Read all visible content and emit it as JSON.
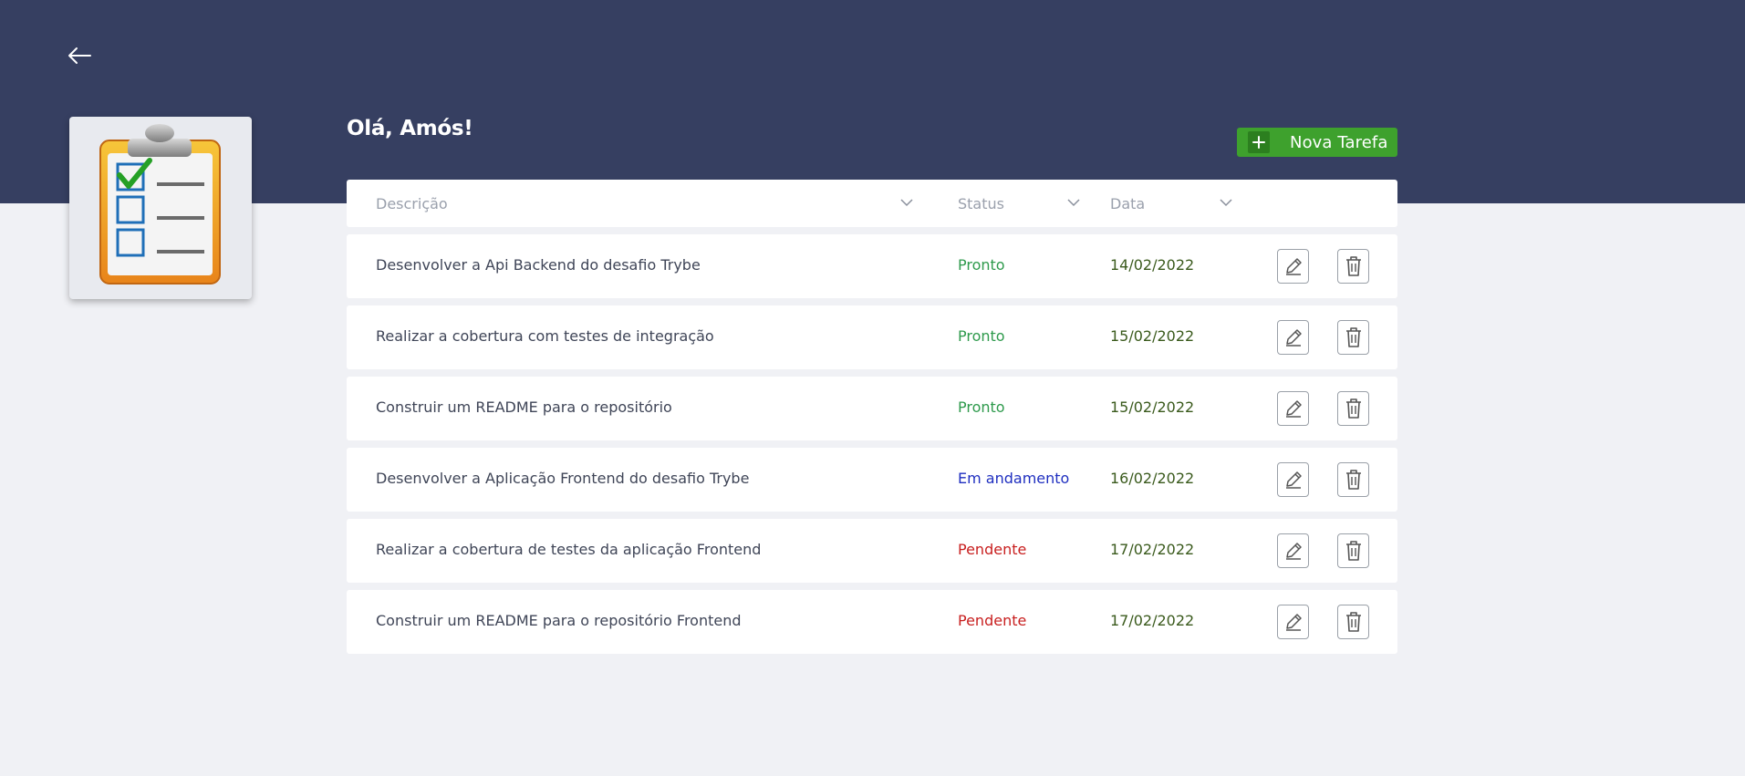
{
  "header": {
    "greeting": "Olá, Amós!",
    "new_task_label": "Nova Tarefa",
    "band_color": "#363f61",
    "icons": {
      "back": "arrow-left-icon",
      "new_task": "plus-icon",
      "logo": "clipboard-checklist-icon"
    }
  },
  "table": {
    "columns": [
      {
        "label": "Descrição",
        "sortable": true
      },
      {
        "label": "Status",
        "sortable": true
      },
      {
        "label": "Data",
        "sortable": true
      }
    ],
    "rows": [
      {
        "description": "Desenvolver a Api Backend do desafio Trybe",
        "status": "Pronto",
        "status_color": "#2e9a4c",
        "date": "14/02/2022"
      },
      {
        "description": "Realizar a cobertura com testes de integração",
        "status": "Pronto",
        "status_color": "#2e9a4c",
        "date": "15/02/2022"
      },
      {
        "description": "Construir um README para o repositório",
        "status": "Pronto",
        "status_color": "#2e9a4c",
        "date": "15/02/2022"
      },
      {
        "description": "Desenvolver a Aplicação Frontend do desafio Trybe",
        "status": "Em andamento",
        "status_color": "#1f2fc0",
        "date": "16/02/2022"
      },
      {
        "description": "Realizar a cobertura de testes da aplicação Frontend",
        "status": "Pendente",
        "status_color": "#c81f1f",
        "date": "17/02/2022"
      },
      {
        "description": "Construir um README para o repositório Frontend",
        "status": "Pendente",
        "status_color": "#c81f1f",
        "date": "17/02/2022"
      }
    ],
    "row_icons": {
      "edit": "pencil-icon",
      "delete": "trash-icon"
    }
  },
  "colors": {
    "accent_green": "#3ea12d",
    "background": "#f0f1f5"
  }
}
